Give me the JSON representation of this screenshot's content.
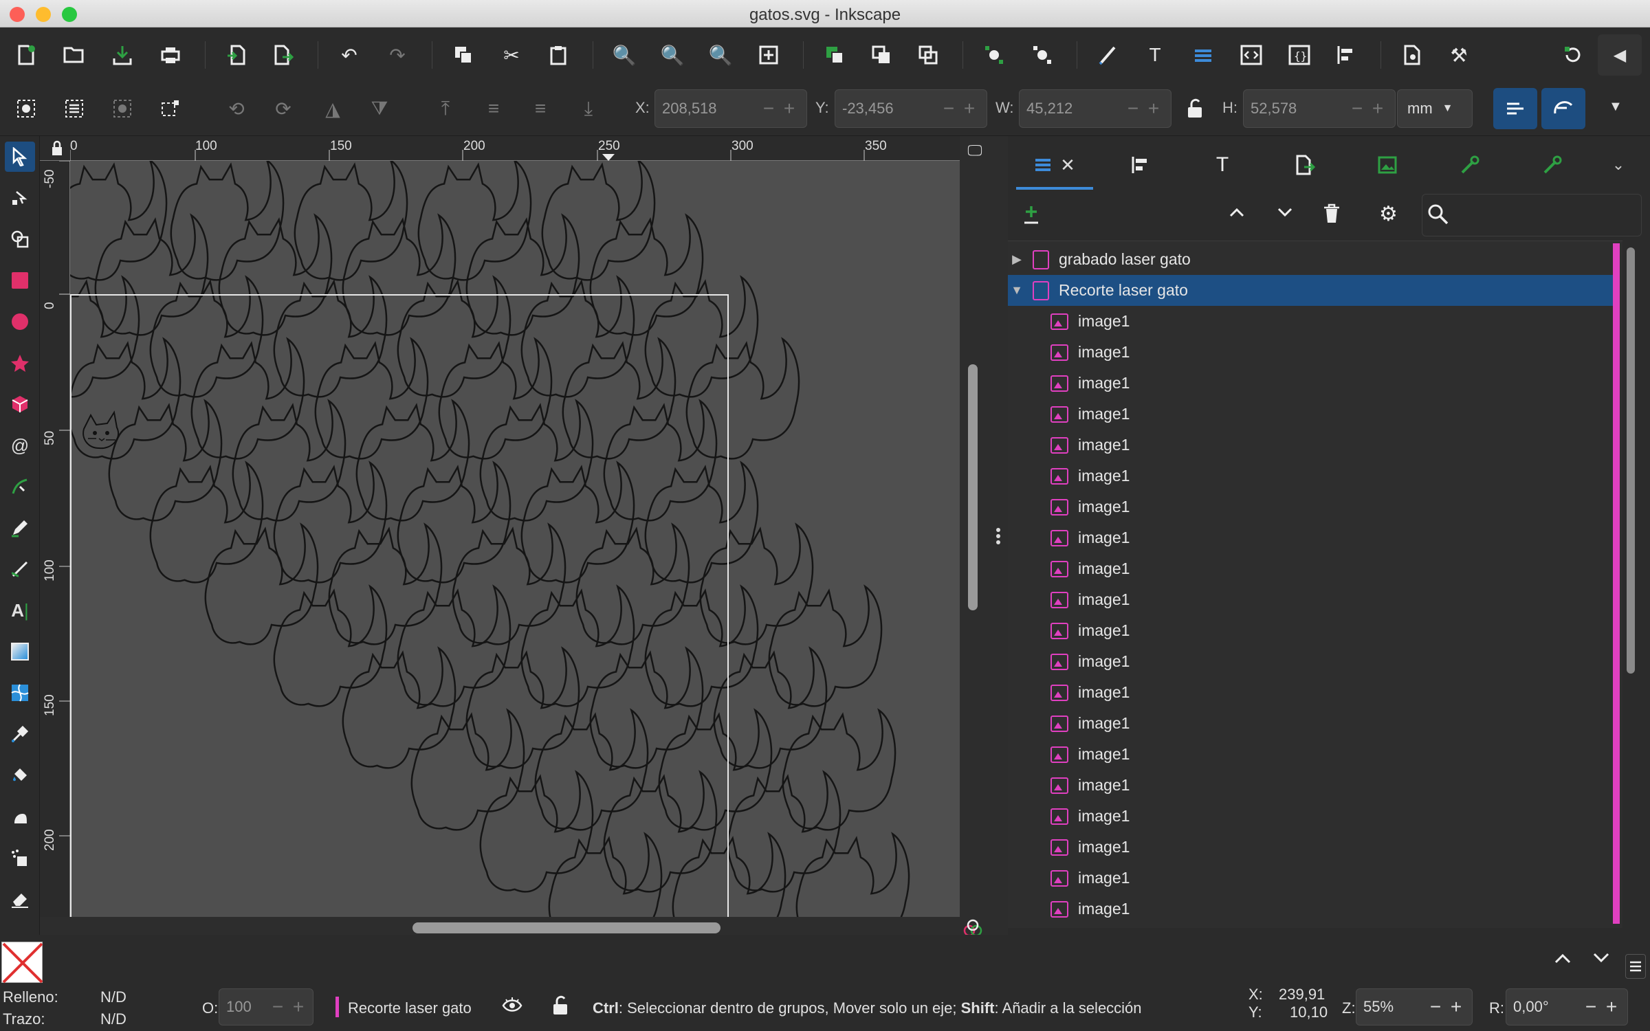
{
  "window": {
    "title": "gatos.svg - Inkscape"
  },
  "colors": {
    "accent": "#1d4d80",
    "layer_pink": "#e040c0",
    "canvas": "#4f4f4f"
  },
  "command_bar": {
    "icons": [
      "new-document-icon",
      "open-icon",
      "save-icon",
      "print-icon",
      "import-icon",
      "export-icon",
      "undo-icon",
      "redo-icon",
      "duplicate-icon",
      "cut-icon",
      "paste-icon",
      "zoom-selection-icon",
      "zoom-drawing-icon",
      "zoom-page-icon",
      "zoom-center-icon",
      "group-icon",
      "ungroup-icon",
      "clone-icon",
      "node-join-icon",
      "node-break-icon",
      "fill-stroke-icon",
      "text-icon",
      "layers-icon",
      "xml-editor-icon",
      "selectors-icon",
      "align-icon",
      "document-properties-icon",
      "preferences-icon",
      "snap-icon",
      "collapse-icon"
    ]
  },
  "tool_controls": {
    "x": {
      "label": "X:",
      "value": "208,518"
    },
    "y": {
      "label": "Y:",
      "value": "-23,456"
    },
    "w": {
      "label": "W:",
      "value": "45,212"
    },
    "h": {
      "label": "H:",
      "value": "52,578"
    },
    "units": "mm"
  },
  "ruler": {
    "h_ticks": [
      "0",
      "100",
      "150",
      "200",
      "250",
      "300",
      "350"
    ],
    "v_ticks": [
      "-50",
      "0",
      "50",
      "100",
      "150",
      "200"
    ]
  },
  "dock": {
    "tabs": [
      "layers-tab",
      "align-tab",
      "text-tab",
      "export-tab",
      "image-tab",
      "tool-tab-1",
      "tool-tab-2"
    ],
    "tree": [
      {
        "label": "grabado  laser gato",
        "type": "layer",
        "expanded": false
      },
      {
        "label": "Recorte laser gato",
        "type": "layer",
        "expanded": true,
        "selected": true
      },
      {
        "label": "image1",
        "type": "image"
      },
      {
        "label": "image1",
        "type": "image"
      },
      {
        "label": "image1",
        "type": "image"
      },
      {
        "label": "image1",
        "type": "image"
      },
      {
        "label": "image1",
        "type": "image"
      },
      {
        "label": "image1",
        "type": "image"
      },
      {
        "label": "image1",
        "type": "image"
      },
      {
        "label": "image1",
        "type": "image"
      },
      {
        "label": "image1",
        "type": "image"
      },
      {
        "label": "image1",
        "type": "image"
      },
      {
        "label": "image1",
        "type": "image"
      },
      {
        "label": "image1",
        "type": "image"
      },
      {
        "label": "image1",
        "type": "image"
      },
      {
        "label": "image1",
        "type": "image"
      },
      {
        "label": "image1",
        "type": "image"
      },
      {
        "label": "image1",
        "type": "image"
      },
      {
        "label": "image1",
        "type": "image"
      },
      {
        "label": "image1",
        "type": "image"
      },
      {
        "label": "image1",
        "type": "image"
      },
      {
        "label": "image1",
        "type": "image"
      }
    ]
  },
  "status": {
    "fill_label": "Relleno:",
    "fill_value": "N/D",
    "stroke_label": "Trazo:",
    "stroke_value": "N/D",
    "opacity_label": "O:",
    "opacity_value": "100",
    "current_layer": "Recorte laser gato",
    "message_ctrl": "Ctrl",
    "message_1": ": Seleccionar dentro de grupos, Mover solo un eje; ",
    "message_shift": "Shift",
    "message_2": ": Añadir a la selección",
    "cursor_x_label": "X:",
    "cursor_x": "239,91",
    "cursor_y_label": "Y:",
    "cursor_y": "10,10",
    "zoom_label": "Z:",
    "zoom_value": "55%",
    "rotation_label": "R:",
    "rotation_value": "0,00°"
  }
}
